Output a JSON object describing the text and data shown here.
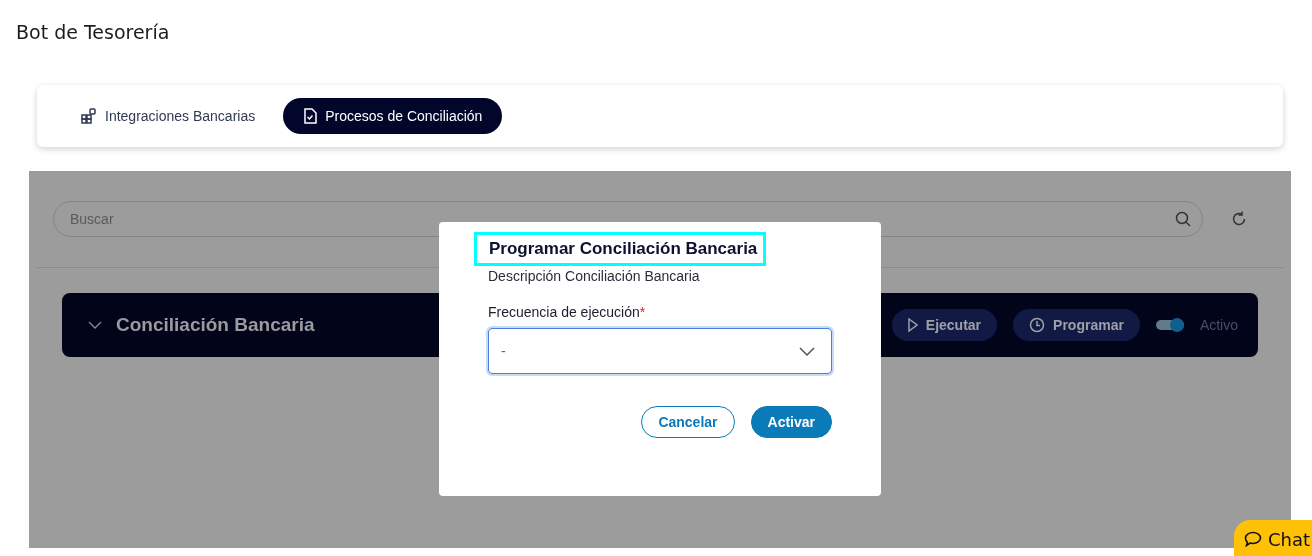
{
  "app_title": "Bot de Tesorería",
  "tabs": [
    {
      "label": "Integraciones Bancarias",
      "selected": false
    },
    {
      "label": "Procesos de Conciliación",
      "selected": true
    }
  ],
  "search": {
    "placeholder": "Buscar"
  },
  "process_card": {
    "title": "Conciliación Bancaria",
    "expanded": false,
    "actions": [
      {
        "label": "Ejecutar",
        "kind": "run"
      },
      {
        "label": "Programar",
        "kind": "schedule"
      }
    ],
    "toggle": {
      "on": true,
      "label": "Activo"
    }
  },
  "dialog": {
    "title": "Programar Conciliación Bancaria",
    "description": "Descripción Conciliación Bancaria",
    "field": {
      "label": "Frecuencia de ejecución",
      "required_mark": "*",
      "value": "-"
    },
    "buttons": [
      {
        "label": "Cancelar",
        "kind": "secondary"
      },
      {
        "label": "Activar",
        "kind": "primary"
      }
    ]
  },
  "chat_button": {
    "label": "Chat"
  }
}
